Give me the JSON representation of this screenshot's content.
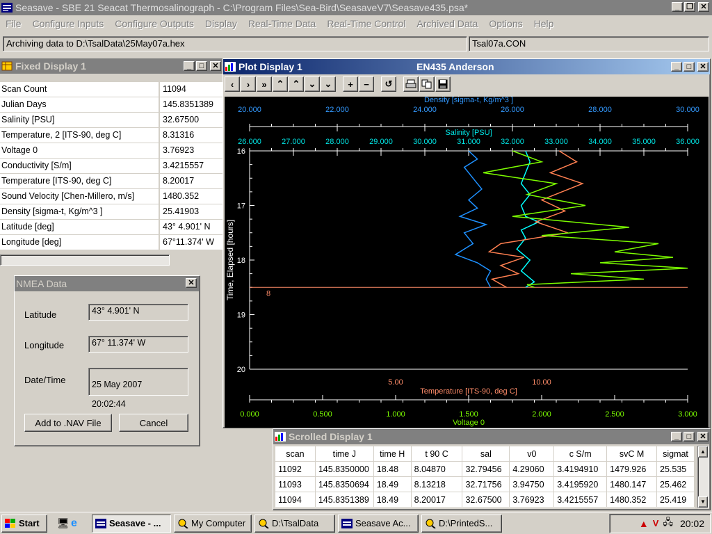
{
  "app": {
    "title": "Seasave - SBE 21 Seacat Thermosalinograph - C:\\Program Files\\Sea-Bird\\SeasaveV7\\Seasave435.psa*"
  },
  "menu": [
    "File",
    "Configure Inputs",
    "Configure Outputs",
    "Display",
    "Real-Time Data",
    "Real-Time Control",
    "Archived Data",
    "Options",
    "Help"
  ],
  "status": {
    "archiving": "Archiving data to D:\\TsalData\\25May07a.hex",
    "con_file": "Tsal07a.CON"
  },
  "fixed_display": {
    "title": "Fixed Display 1",
    "rows": [
      {
        "name": "Scan Count",
        "value": "11094"
      },
      {
        "name": "Julian Days",
        "value": "145.8351389"
      },
      {
        "name": "Salinity [PSU]",
        "value": "32.67500"
      },
      {
        "name": "Temperature, 2 [ITS-90, deg C]",
        "value": "8.31316"
      },
      {
        "name": "Voltage 0",
        "value": "3.76923"
      },
      {
        "name": "Conductivity [S/m]",
        "value": "3.4215557"
      },
      {
        "name": "Temperature [ITS-90, deg C]",
        "value": "8.20017"
      },
      {
        "name": "Sound Velocity [Chen-Millero, m/s]",
        "value": "1480.352"
      },
      {
        "name": "Density [sigma-t, Kg/m^3 ]",
        "value": "25.41903"
      },
      {
        "name": "Latitude [deg]",
        "value": " 43° 4.901' N"
      },
      {
        "name": "Longitude [deg]",
        "value": "67°11.374' W"
      }
    ]
  },
  "nmea": {
    "title": "NMEA Data",
    "latitude_label": "Latitude",
    "latitude": "43°  4.901' N",
    "longitude_label": "Longitude",
    "longitude": "67° 11.374' W",
    "datetime_label": "Date/Time",
    "date": "25 May 2007",
    "time": "20:02:44",
    "add_button": "Add to .NAV File",
    "cancel_button": "Cancel"
  },
  "plot_window": {
    "title": "Plot Display 1",
    "subtitle": "EN435 Anderson"
  },
  "chart_data": {
    "type": "line",
    "background": "#000000",
    "y_axis": {
      "label": "Time, Elapsed [hours]",
      "ylim": [
        16,
        20
      ],
      "ticks": [
        "16",
        "17",
        "18",
        "19",
        "20"
      ],
      "inverted": true,
      "color": "#ffffff"
    },
    "x_axes": [
      {
        "name": "density",
        "label": "Density [sigma-t, Kg/m^3 ]",
        "xlim": [
          20,
          30
        ],
        "ticks": [
          "20.000",
          "22.000",
          "24.000",
          "26.000",
          "28.000",
          "30.000"
        ],
        "color": "#3399ff",
        "position": "top-outer"
      },
      {
        "name": "salinity",
        "label": "Salinity [PSU]",
        "xlim": [
          26,
          36
        ],
        "ticks": [
          "26.000",
          "27.000",
          "28.000",
          "29.000",
          "30.000",
          "31.000",
          "32.000",
          "33.000",
          "34.000",
          "35.000",
          "36.000"
        ],
        "color": "#00e5e5",
        "position": "top-inner"
      },
      {
        "name": "temperature",
        "label": "Temperature [ITS-90, deg C]",
        "xlim": [
          0,
          15
        ],
        "ticks": [
          "5.00",
          "10.00"
        ],
        "color": "#ff8c69",
        "position": "bottom-inner"
      },
      {
        "name": "voltage",
        "label": "Voltage 0",
        "xlim": [
          0,
          3
        ],
        "ticks": [
          "0.000",
          "0.500",
          "1.000",
          "1.500",
          "2.000",
          "2.500",
          "3.000"
        ],
        "color": "#7cfc00",
        "position": "bottom-outer"
      }
    ],
    "marker": {
      "y": 18.5,
      "label": "8",
      "color": "#ff8c69"
    },
    "series": [
      {
        "axis": "density",
        "color": "#1e90ff",
        "points": [
          [
            25.0,
            16.0
          ],
          [
            25.2,
            16.15
          ],
          [
            24.9,
            16.3
          ],
          [
            25.1,
            16.5
          ],
          [
            25.3,
            16.7
          ],
          [
            25.0,
            16.9
          ],
          [
            25.2,
            17.05
          ],
          [
            24.8,
            17.2
          ],
          [
            25.4,
            17.35
          ],
          [
            24.9,
            17.5
          ],
          [
            25.1,
            17.7
          ],
          [
            24.7,
            17.9
          ],
          [
            25.2,
            18.05
          ],
          [
            25.5,
            18.2
          ],
          [
            25.4,
            18.35
          ],
          [
            25.5,
            18.5
          ]
        ]
      },
      {
        "axis": "salinity",
        "color": "#00ffff",
        "points": [
          [
            32.3,
            16.0
          ],
          [
            32.4,
            16.2
          ],
          [
            32.3,
            16.4
          ],
          [
            32.2,
            16.6
          ],
          [
            32.4,
            16.8
          ],
          [
            32.2,
            17.0
          ],
          [
            32.3,
            17.2
          ],
          [
            32.6,
            17.3
          ],
          [
            32.2,
            17.45
          ],
          [
            32.3,
            17.6
          ],
          [
            32.1,
            17.8
          ],
          [
            32.4,
            18.0
          ],
          [
            32.2,
            18.2
          ],
          [
            32.5,
            18.4
          ],
          [
            32.3,
            18.5
          ]
        ]
      },
      {
        "axis": "temperature",
        "color": "#ff7f50",
        "points": [
          [
            10.6,
            16.0
          ],
          [
            11.2,
            16.2
          ],
          [
            10.3,
            16.4
          ],
          [
            11.4,
            16.6
          ],
          [
            10.0,
            16.9
          ],
          [
            10.8,
            17.1
          ],
          [
            9.8,
            17.3
          ],
          [
            10.9,
            17.5
          ],
          [
            8.6,
            17.7
          ],
          [
            8.2,
            17.85
          ],
          [
            9.4,
            17.95
          ],
          [
            8.6,
            18.1
          ],
          [
            9.2,
            18.25
          ],
          [
            8.3,
            18.35
          ],
          [
            8.8,
            18.5
          ]
        ]
      },
      {
        "axis": "voltage",
        "color": "#7cfc00",
        "points": [
          [
            1.8,
            16.0
          ],
          [
            2.0,
            16.2
          ],
          [
            1.6,
            16.4
          ],
          [
            2.1,
            16.6
          ],
          [
            1.9,
            16.8
          ],
          [
            2.3,
            17.0
          ],
          [
            1.8,
            17.2
          ],
          [
            2.6,
            17.4
          ],
          [
            2.0,
            17.55
          ],
          [
            2.8,
            17.7
          ],
          [
            2.5,
            17.85
          ],
          [
            2.9,
            17.95
          ],
          [
            2.4,
            18.05
          ],
          [
            3.0,
            18.15
          ],
          [
            2.2,
            18.25
          ],
          [
            2.7,
            18.35
          ],
          [
            1.9,
            18.45
          ],
          [
            1.95,
            18.5
          ]
        ]
      }
    ]
  },
  "scrolled": {
    "title": "Scrolled Display 1",
    "headers": [
      "scan",
      "time J",
      "time H",
      "t 90 C",
      "sal",
      "v0",
      "c S/m",
      "svC M",
      "sigmat"
    ],
    "rows": [
      [
        "11092",
        "145.8350000",
        "18.48",
        "8.04870",
        "32.79456",
        "4.29060",
        "3.4194910",
        "1479.926",
        "25.535"
      ],
      [
        "11093",
        "145.8350694",
        "18.49",
        "8.13218",
        "32.71756",
        "3.94750",
        "3.4195920",
        "1480.147",
        "25.462"
      ],
      [
        "11094",
        "145.8351389",
        "18.49",
        "8.20017",
        "32.67500",
        "3.76923",
        "3.4215557",
        "1480.352",
        "25.419"
      ]
    ]
  },
  "taskbar": {
    "start": "Start",
    "tasks": [
      "Seasave - ...",
      "My Computer",
      "D:\\TsalData",
      "Seasave Ac...",
      "D:\\PrintedS..."
    ],
    "clock": "20:02"
  },
  "colors": {
    "title_active": "#0a246a",
    "desktop_bg": "#d4d0c8"
  }
}
